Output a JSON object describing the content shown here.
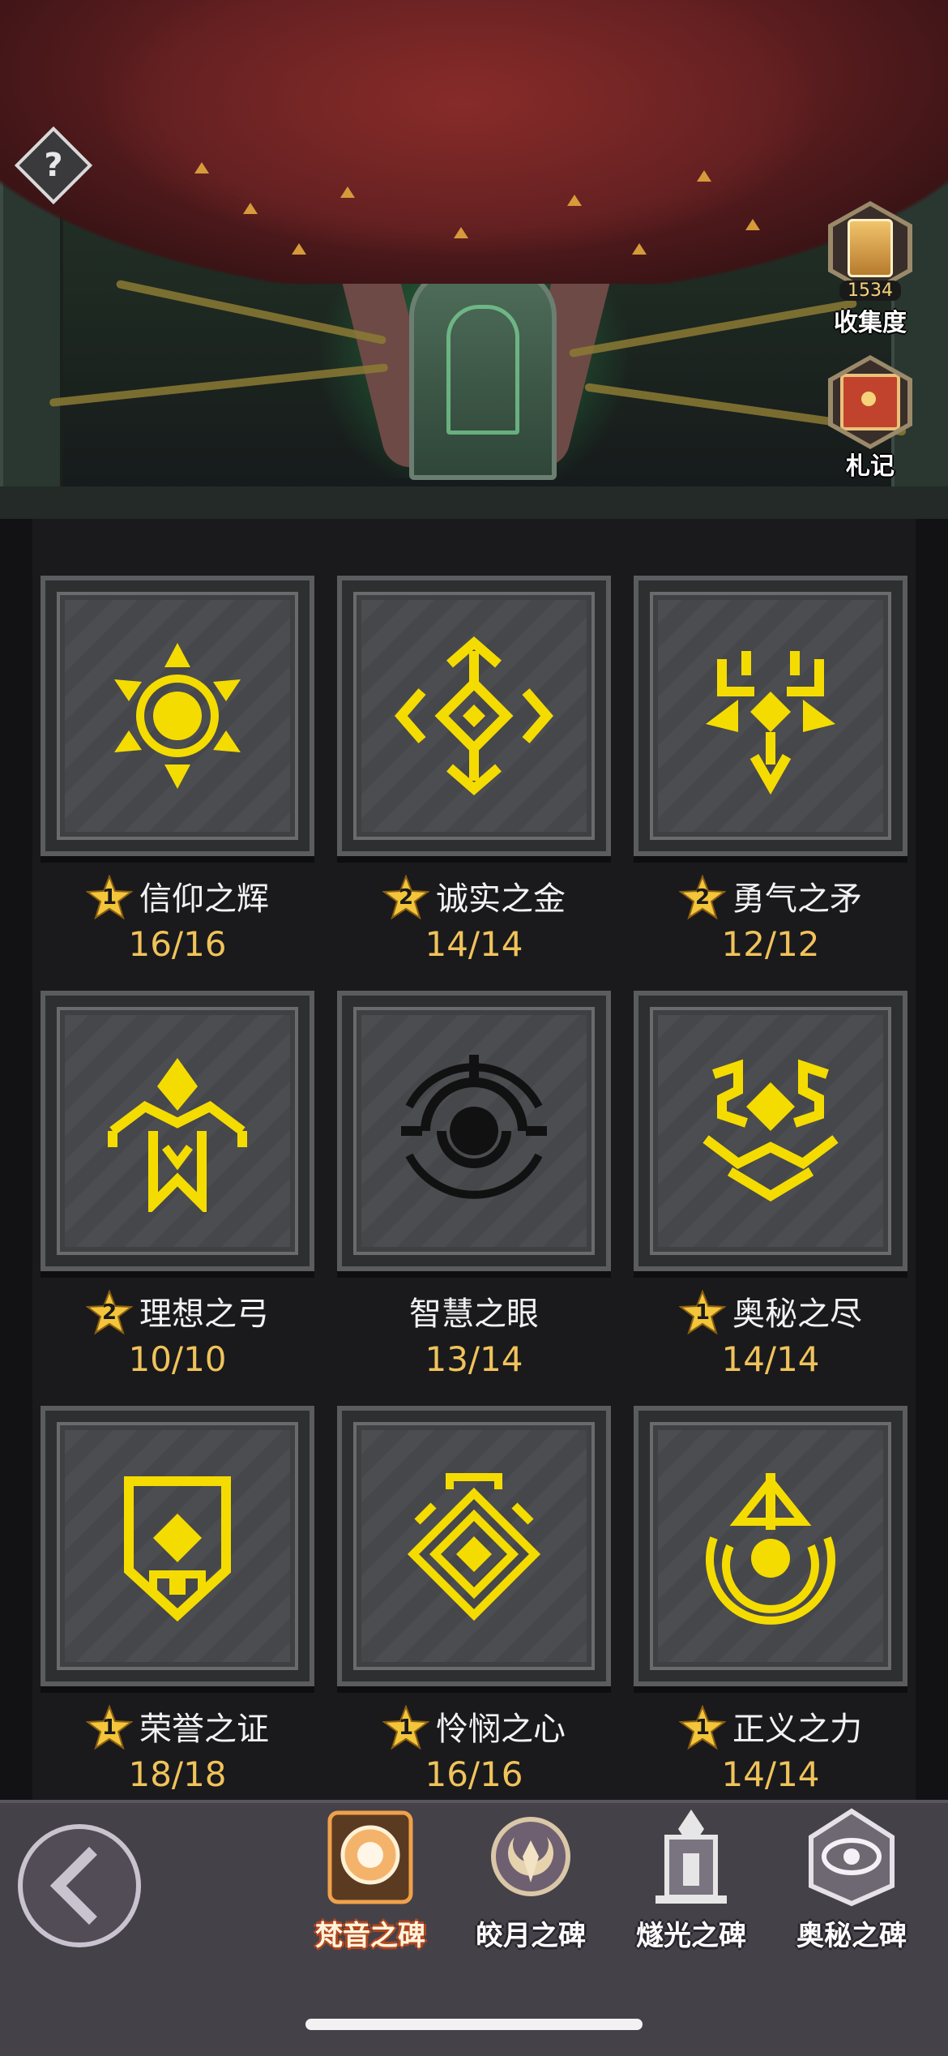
{
  "header": {
    "help_icon_text": "?",
    "collection": {
      "count": "1534",
      "label": "收集度"
    },
    "journal": {
      "label": "札记"
    }
  },
  "tiles": [
    {
      "name": "信仰之辉",
      "star": "1",
      "progress": "16/16",
      "symbol": "sun-symbol-icon"
    },
    {
      "name": "诚实之金",
      "star": "2",
      "progress": "14/14",
      "symbol": "diamond-cross-symbol-icon"
    },
    {
      "name": "勇气之矛",
      "star": "2",
      "progress": "12/12",
      "symbol": "trident-symbol-icon"
    },
    {
      "name": "理想之弓",
      "star": "2",
      "progress": "10/10",
      "symbol": "arrow-symbol-icon"
    },
    {
      "name": "智慧之眼",
      "star": "",
      "progress": "13/14",
      "symbol": "eye-symbol-icon"
    },
    {
      "name": "奥秘之尽",
      "star": "1",
      "progress": "14/14",
      "symbol": "crown-symbol-icon"
    },
    {
      "name": "荣誉之证",
      "star": "1",
      "progress": "18/18",
      "symbol": "shield-symbol-icon"
    },
    {
      "name": "怜悯之心",
      "star": "1",
      "progress": "16/16",
      "symbol": "layered-diamond-symbol-icon"
    },
    {
      "name": "正义之力",
      "star": "1",
      "progress": "14/14",
      "symbol": "orb-symbol-icon"
    }
  ],
  "nav": {
    "items": [
      {
        "label": "梵音之碑",
        "active": true
      },
      {
        "label": "皎月之碑",
        "active": false
      },
      {
        "label": "燧光之碑",
        "active": false
      },
      {
        "label": "奥秘之碑",
        "active": false
      }
    ]
  },
  "colors": {
    "symbol": "#f5dc00",
    "count": "#f0c35a",
    "star": "#f3c53a"
  }
}
